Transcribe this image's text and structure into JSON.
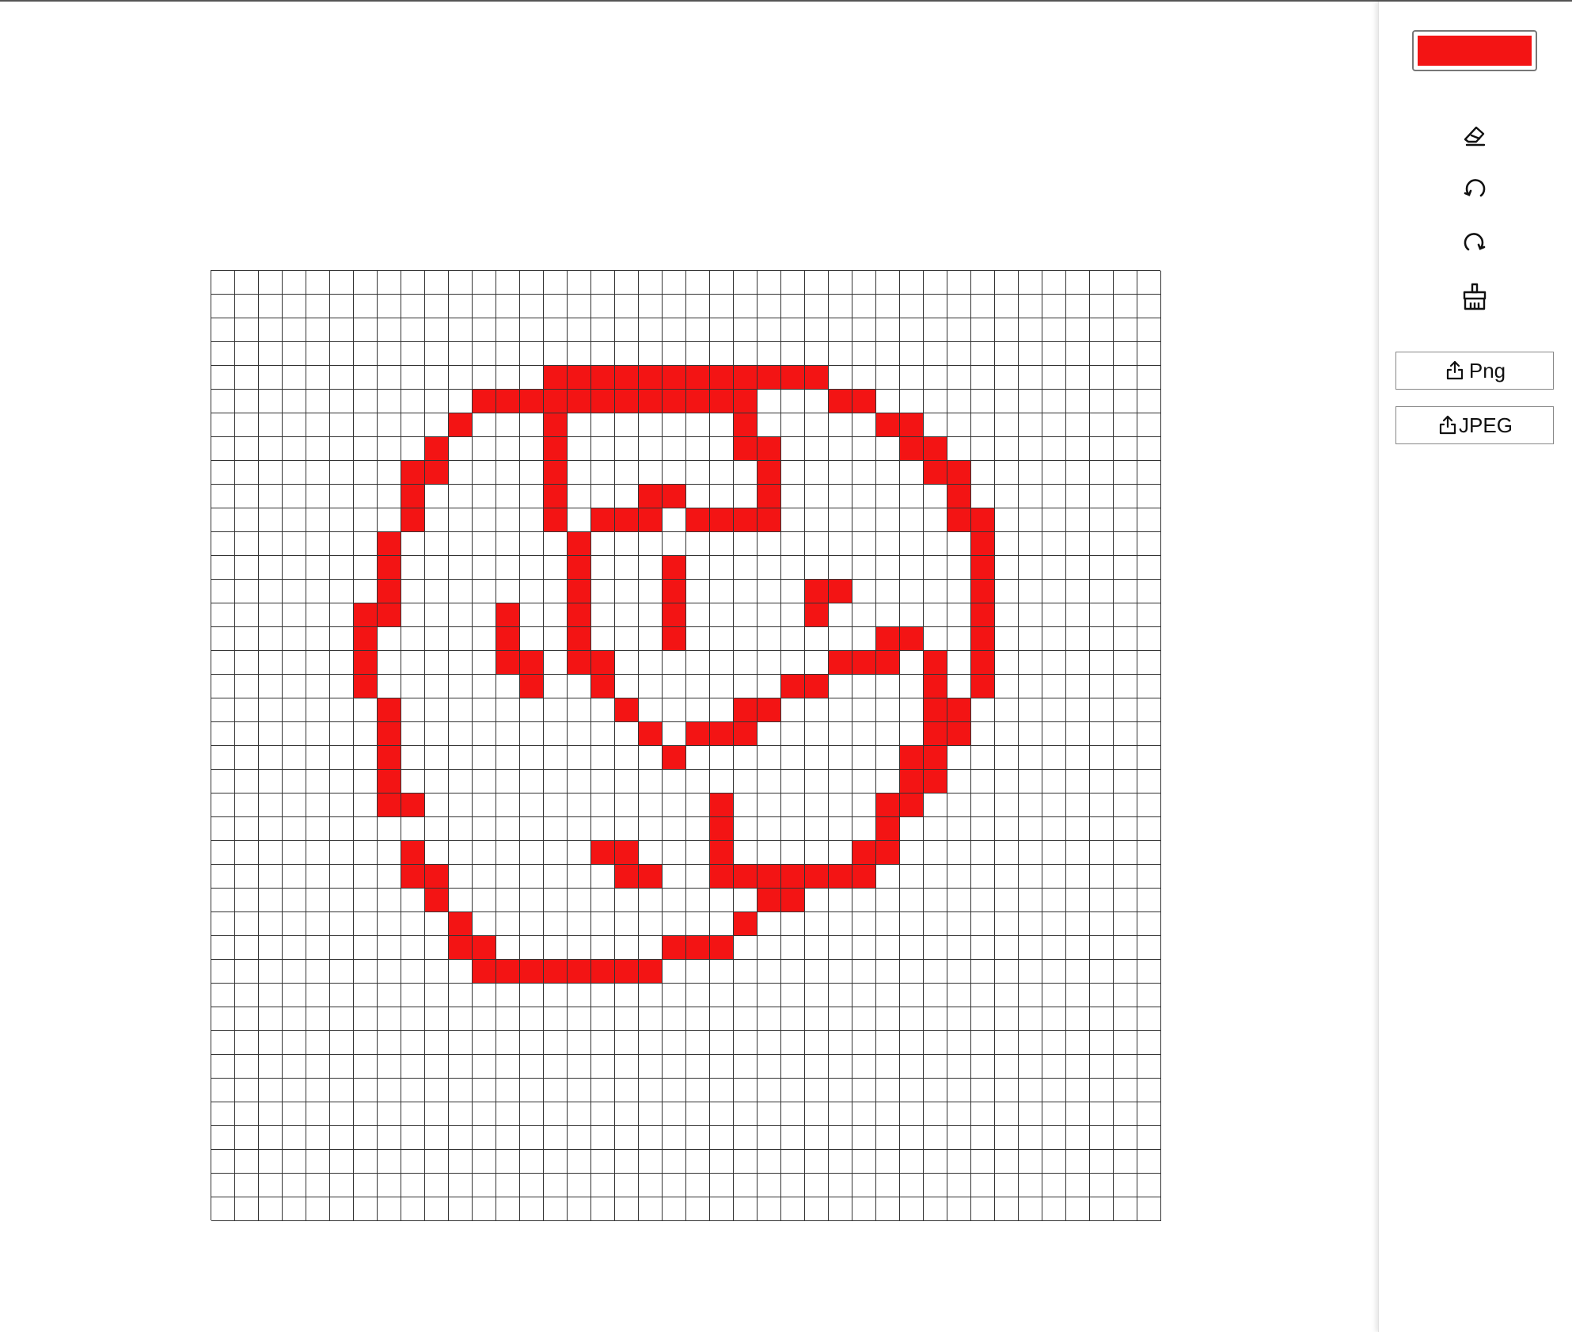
{
  "app": {
    "selected_color": "#f31414",
    "grid_size": 40
  },
  "toolbar": {
    "tools": [
      {
        "name": "eraser-icon"
      },
      {
        "name": "undo-icon"
      },
      {
        "name": "redo-icon"
      },
      {
        "name": "clear-brush-icon"
      }
    ],
    "export_png_label": "Png",
    "export_jpeg_label": "JPEG",
    "export_icon": "share-icon"
  },
  "canvas": {
    "rows": 40,
    "cols": 40,
    "fill_color": "#f31414",
    "filled_cells": [
      [
        4,
        14
      ],
      [
        4,
        15
      ],
      [
        4,
        16
      ],
      [
        4,
        17
      ],
      [
        4,
        18
      ],
      [
        4,
        19
      ],
      [
        4,
        20
      ],
      [
        4,
        21
      ],
      [
        4,
        22
      ],
      [
        4,
        23
      ],
      [
        4,
        24
      ],
      [
        4,
        25
      ],
      [
        5,
        11
      ],
      [
        5,
        12
      ],
      [
        5,
        13
      ],
      [
        5,
        14
      ],
      [
        5,
        15
      ],
      [
        5,
        16
      ],
      [
        5,
        17
      ],
      [
        5,
        18
      ],
      [
        5,
        19
      ],
      [
        5,
        20
      ],
      [
        5,
        21
      ],
      [
        5,
        22
      ],
      [
        5,
        26
      ],
      [
        5,
        27
      ],
      [
        6,
        10
      ],
      [
        6,
        14
      ],
      [
        6,
        22
      ],
      [
        6,
        28
      ],
      [
        6,
        29
      ],
      [
        7,
        9
      ],
      [
        7,
        14
      ],
      [
        7,
        22
      ],
      [
        7,
        23
      ],
      [
        7,
        29
      ],
      [
        7,
        30
      ],
      [
        8,
        8
      ],
      [
        8,
        9
      ],
      [
        8,
        14
      ],
      [
        8,
        23
      ],
      [
        8,
        30
      ],
      [
        8,
        31
      ],
      [
        9,
        8
      ],
      [
        9,
        14
      ],
      [
        9,
        18
      ],
      [
        9,
        19
      ],
      [
        9,
        23
      ],
      [
        9,
        31
      ],
      [
        10,
        8
      ],
      [
        10,
        14
      ],
      [
        10,
        16
      ],
      [
        10,
        17
      ],
      [
        10,
        18
      ],
      [
        10,
        20
      ],
      [
        10,
        21
      ],
      [
        10,
        22
      ],
      [
        10,
        23
      ],
      [
        10,
        31
      ],
      [
        10,
        32
      ],
      [
        11,
        7
      ],
      [
        11,
        15
      ],
      [
        11,
        32
      ],
      [
        12,
        7
      ],
      [
        12,
        15
      ],
      [
        12,
        19
      ],
      [
        12,
        32
      ],
      [
        13,
        7
      ],
      [
        13,
        15
      ],
      [
        13,
        19
      ],
      [
        13,
        25
      ],
      [
        13,
        26
      ],
      [
        13,
        32
      ],
      [
        14,
        6
      ],
      [
        14,
        7
      ],
      [
        14,
        12
      ],
      [
        14,
        15
      ],
      [
        14,
        19
      ],
      [
        14,
        25
      ],
      [
        14,
        32
      ],
      [
        15,
        6
      ],
      [
        15,
        12
      ],
      [
        15,
        15
      ],
      [
        15,
        19
      ],
      [
        15,
        28
      ],
      [
        15,
        29
      ],
      [
        15,
        32
      ],
      [
        16,
        6
      ],
      [
        16,
        12
      ],
      [
        16,
        13
      ],
      [
        16,
        15
      ],
      [
        16,
        16
      ],
      [
        16,
        26
      ],
      [
        16,
        27
      ],
      [
        16,
        28
      ],
      [
        16,
        30
      ],
      [
        16,
        32
      ],
      [
        17,
        6
      ],
      [
        17,
        13
      ],
      [
        17,
        16
      ],
      [
        17,
        24
      ],
      [
        17,
        25
      ],
      [
        17,
        30
      ],
      [
        17,
        32
      ],
      [
        18,
        7
      ],
      [
        18,
        17
      ],
      [
        18,
        22
      ],
      [
        18,
        23
      ],
      [
        18,
        30
      ],
      [
        18,
        31
      ],
      [
        19,
        7
      ],
      [
        19,
        18
      ],
      [
        19,
        20
      ],
      [
        19,
        21
      ],
      [
        19,
        22
      ],
      [
        19,
        30
      ],
      [
        19,
        31
      ],
      [
        20,
        7
      ],
      [
        20,
        19
      ],
      [
        20,
        29
      ],
      [
        20,
        30
      ],
      [
        21,
        7
      ],
      [
        21,
        29
      ],
      [
        21,
        30
      ],
      [
        22,
        7
      ],
      [
        22,
        8
      ],
      [
        22,
        21
      ],
      [
        22,
        28
      ],
      [
        22,
        29
      ],
      [
        23,
        21
      ],
      [
        23,
        28
      ],
      [
        24,
        8
      ],
      [
        24,
        16
      ],
      [
        24,
        17
      ],
      [
        24,
        21
      ],
      [
        24,
        27
      ],
      [
        24,
        28
      ],
      [
        25,
        8
      ],
      [
        25,
        9
      ],
      [
        25,
        17
      ],
      [
        25,
        18
      ],
      [
        25,
        21
      ],
      [
        25,
        22
      ],
      [
        25,
        23
      ],
      [
        25,
        24
      ],
      [
        25,
        25
      ],
      [
        25,
        26
      ],
      [
        25,
        27
      ],
      [
        26,
        9
      ],
      [
        26,
        23
      ],
      [
        26,
        24
      ],
      [
        27,
        10
      ],
      [
        27,
        22
      ],
      [
        28,
        10
      ],
      [
        28,
        11
      ],
      [
        28,
        19
      ],
      [
        28,
        20
      ],
      [
        28,
        21
      ],
      [
        29,
        11
      ],
      [
        29,
        12
      ],
      [
        29,
        13
      ],
      [
        29,
        14
      ],
      [
        29,
        15
      ],
      [
        29,
        16
      ],
      [
        29,
        17
      ],
      [
        29,
        18
      ]
    ]
  }
}
